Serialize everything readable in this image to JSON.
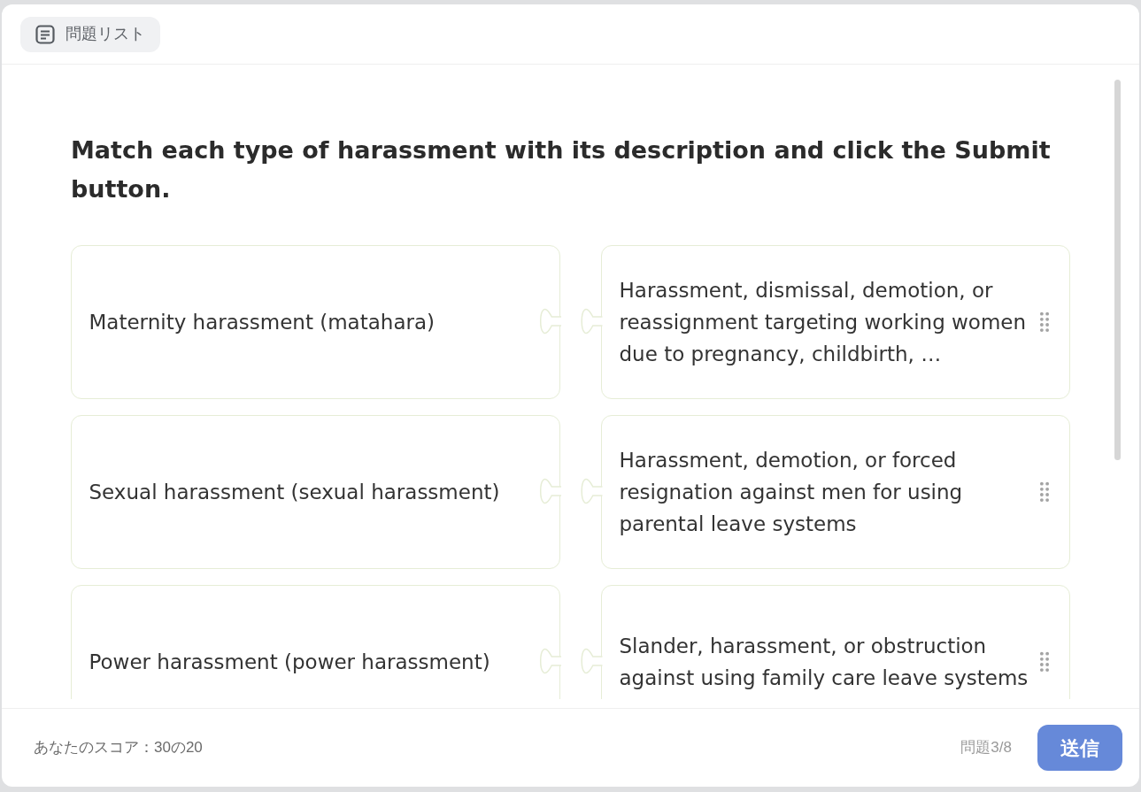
{
  "header": {
    "question_list_button": "問題リスト"
  },
  "question": "Match each type of harassment with its description and click the Submit button.",
  "rows": [
    {
      "term": "Maternity harassment (matahara)",
      "description": "Harassment, dismissal, demotion, or reassignment targeting working women due to pregnancy, childbirth, …"
    },
    {
      "term": "Sexual harassment (sexual harassment)",
      "description": "Harassment, demotion, or forced resignation against men for using parental leave systems"
    },
    {
      "term": "Power harassment (power harassment)",
      "description": "Slander, harassment, or obstruction against using family care leave systems"
    }
  ],
  "footer": {
    "score": "あなたのスコア：30の20",
    "progress": "問題3/8",
    "submit_button": "送信"
  }
}
